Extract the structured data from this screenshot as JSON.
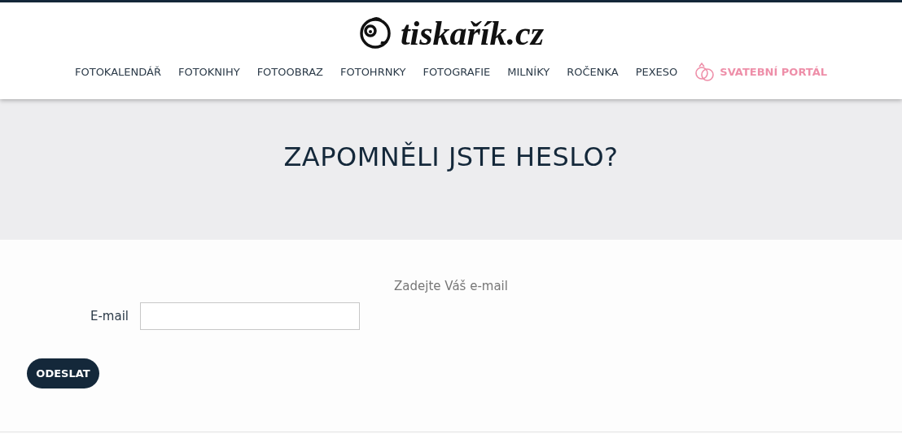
{
  "logo": {
    "text": "tiskařík.cz"
  },
  "nav": [
    {
      "label": "FOTOKALENDÁŘ",
      "kind": "link"
    },
    {
      "label": "FOTOKNIHY",
      "kind": "link"
    },
    {
      "label": "FOTOOBRAZ",
      "kind": "link"
    },
    {
      "label": "FOTOHRNKY",
      "kind": "link"
    },
    {
      "label": "FOTOGRAFIE",
      "kind": "link"
    },
    {
      "label": "MILNÍKY",
      "kind": "link"
    },
    {
      "label": "ROČENKA",
      "kind": "link"
    },
    {
      "label": "PEXESO",
      "kind": "link"
    },
    {
      "label": "SVATEBNÍ PORTÁL",
      "kind": "wedding"
    }
  ],
  "page_title": "ZAPOMNĚLI JSTE HESLO?",
  "form": {
    "hint": "Zadejte Váš e-mail",
    "email_label": "E-mail",
    "submit": "ODESLAT"
  }
}
